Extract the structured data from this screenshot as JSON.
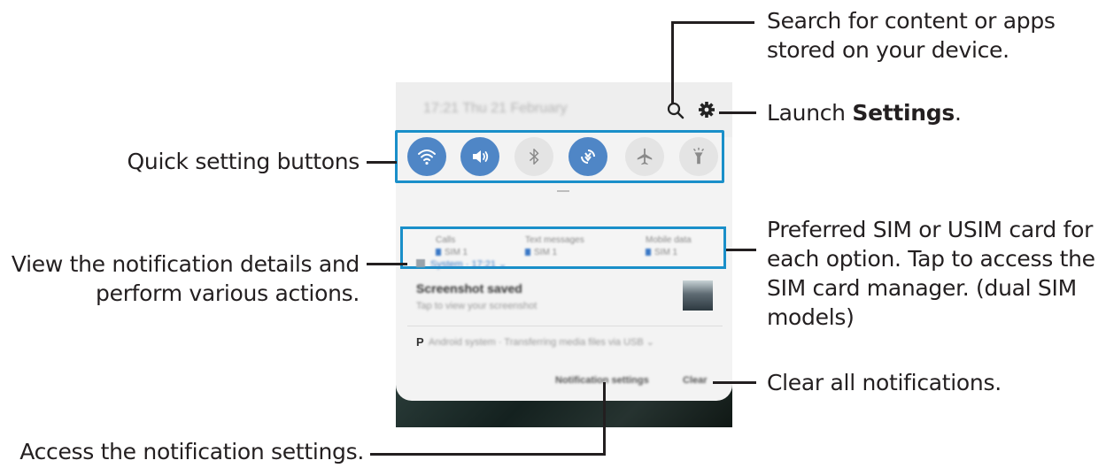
{
  "colors": {
    "accent": "#1a8fc9",
    "toggle_on": "#4f86c6",
    "toggle_off": "#e4e4e4",
    "text": "#231f20"
  },
  "callouts": {
    "search": [
      "Search for content or apps",
      "stored on your device."
    ],
    "settings_prefix": "Launch ",
    "settings_bold": "Settings",
    "settings_suffix": ".",
    "quick": "Quick setting buttons",
    "sim": [
      "Preferred SIM or USIM card for",
      "each option. Tap to access the",
      "SIM card manager. (dual SIM",
      "models)"
    ],
    "details": [
      "View the notification details and",
      "perform various actions."
    ],
    "clear": "Clear all notifications.",
    "notif_settings": "Access the notification settings."
  },
  "panel": {
    "datetime": "17:21  Thu 21 February",
    "quick_buttons": [
      {
        "icon": "wifi-icon",
        "state": "on"
      },
      {
        "icon": "sound-icon",
        "state": "on"
      },
      {
        "icon": "bluetooth-icon",
        "state": "off"
      },
      {
        "icon": "auto-rotate-icon",
        "state": "on"
      },
      {
        "icon": "airplane-icon",
        "state": "off"
      },
      {
        "icon": "flashlight-icon",
        "state": "off"
      }
    ],
    "sim_options": [
      {
        "label": "Calls",
        "value": "SIM 1"
      },
      {
        "label": "Text messages",
        "value": "SIM 1"
      },
      {
        "label": "Mobile data",
        "value": "SIM 1"
      }
    ],
    "notification": {
      "app": "System  ·  17:21  ⌄",
      "title": "Screenshot saved",
      "subtitle": "Tap to view your screenshot"
    },
    "android_system": "Android system  ·  Transferring media files via USB  ⌄",
    "notification_settings_label": "Notification settings",
    "clear_label": "Clear"
  }
}
